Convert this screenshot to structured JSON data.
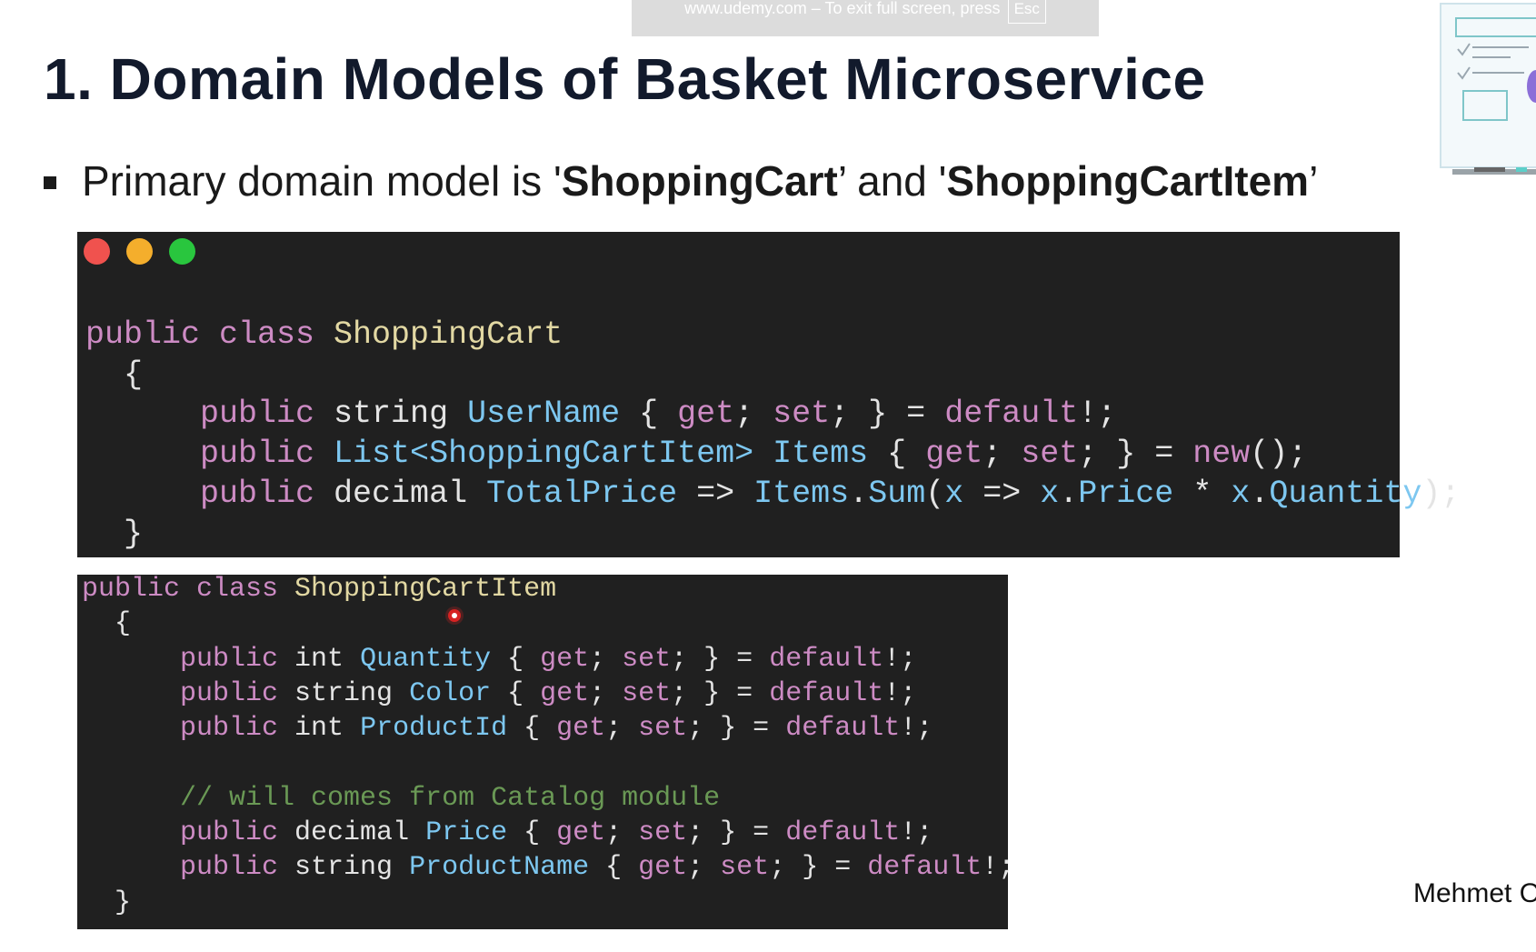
{
  "fullscreen_notice": {
    "text": "www.udemy.com – To exit full screen, press",
    "key": "Esc"
  },
  "slide": {
    "title": "1. Domain Models of Basket Microservice",
    "bullet": {
      "prefix": "Primary domain model is '",
      "model1": "ShoppingCart",
      "middle": "’ and '",
      "model2": "ShoppingCartItem",
      "suffix": "’"
    },
    "author": "Mehmet O"
  },
  "code_top": {
    "window_dots": [
      "close",
      "minimize",
      "maximize"
    ],
    "lines": [
      [
        {
          "t": "public class ",
          "c": "kw"
        },
        {
          "t": "ShoppingCart",
          "c": "cls"
        }
      ],
      [
        {
          "t": "  {",
          "c": "pun"
        }
      ],
      [
        {
          "t": "      public ",
          "c": "kw"
        },
        {
          "t": "string ",
          "c": "ty"
        },
        {
          "t": "UserName",
          "c": "prop"
        },
        {
          "t": " { ",
          "c": "pun"
        },
        {
          "t": "get",
          "c": "kw"
        },
        {
          "t": "; ",
          "c": "pun"
        },
        {
          "t": "set",
          "c": "kw"
        },
        {
          "t": "; } = ",
          "c": "pun"
        },
        {
          "t": "default",
          "c": "kw"
        },
        {
          "t": "!;",
          "c": "pun"
        }
      ],
      [
        {
          "t": "      public ",
          "c": "kw"
        },
        {
          "t": "List<ShoppingCartItem>",
          "c": "prop"
        },
        {
          "t": " ",
          "c": "pun"
        },
        {
          "t": "Items",
          "c": "prop"
        },
        {
          "t": " { ",
          "c": "pun"
        },
        {
          "t": "get",
          "c": "kw"
        },
        {
          "t": "; ",
          "c": "pun"
        },
        {
          "t": "set",
          "c": "kw"
        },
        {
          "t": "; } = ",
          "c": "pun"
        },
        {
          "t": "new",
          "c": "kw"
        },
        {
          "t": "();",
          "c": "pun"
        }
      ],
      [
        {
          "t": "      public ",
          "c": "kw"
        },
        {
          "t": "decimal ",
          "c": "ty"
        },
        {
          "t": "TotalPrice",
          "c": "prop"
        },
        {
          "t": " => ",
          "c": "pun"
        },
        {
          "t": "Items",
          "c": "prop"
        },
        {
          "t": ".",
          "c": "pun"
        },
        {
          "t": "Sum",
          "c": "prop"
        },
        {
          "t": "(",
          "c": "pun"
        },
        {
          "t": "x",
          "c": "prop"
        },
        {
          "t": " => ",
          "c": "pun"
        },
        {
          "t": "x",
          "c": "prop"
        },
        {
          "t": ".",
          "c": "pun"
        },
        {
          "t": "Price",
          "c": "prop"
        },
        {
          "t": " * ",
          "c": "pun"
        },
        {
          "t": "x",
          "c": "prop"
        },
        {
          "t": ".",
          "c": "pun"
        },
        {
          "t": "Quantity",
          "c": "prop"
        },
        {
          "t": ");",
          "c": "pun"
        }
      ],
      [
        {
          "t": "  }",
          "c": "pun"
        }
      ]
    ]
  },
  "code_bottom": {
    "lines": [
      [
        {
          "t": "public class ",
          "c": "kw"
        },
        {
          "t": "ShoppingCartItem",
          "c": "cls"
        }
      ],
      [
        {
          "t": "  {",
          "c": "pun"
        }
      ],
      [
        {
          "t": "      public ",
          "c": "kw"
        },
        {
          "t": "int ",
          "c": "ty"
        },
        {
          "t": "Quantity",
          "c": "prop"
        },
        {
          "t": " { ",
          "c": "pun"
        },
        {
          "t": "get",
          "c": "kw"
        },
        {
          "t": "; ",
          "c": "pun"
        },
        {
          "t": "set",
          "c": "kw"
        },
        {
          "t": "; } = ",
          "c": "pun"
        },
        {
          "t": "default",
          "c": "kw"
        },
        {
          "t": "!;",
          "c": "pun"
        }
      ],
      [
        {
          "t": "      public ",
          "c": "kw"
        },
        {
          "t": "string ",
          "c": "ty"
        },
        {
          "t": "Color",
          "c": "prop"
        },
        {
          "t": " { ",
          "c": "pun"
        },
        {
          "t": "get",
          "c": "kw"
        },
        {
          "t": "; ",
          "c": "pun"
        },
        {
          "t": "set",
          "c": "kw"
        },
        {
          "t": "; } = ",
          "c": "pun"
        },
        {
          "t": "default",
          "c": "kw"
        },
        {
          "t": "!;",
          "c": "pun"
        }
      ],
      [
        {
          "t": "      public ",
          "c": "kw"
        },
        {
          "t": "int ",
          "c": "ty"
        },
        {
          "t": "ProductId",
          "c": "prop"
        },
        {
          "t": " { ",
          "c": "pun"
        },
        {
          "t": "get",
          "c": "kw"
        },
        {
          "t": "; ",
          "c": "pun"
        },
        {
          "t": "set",
          "c": "kw"
        },
        {
          "t": "; } = ",
          "c": "pun"
        },
        {
          "t": "default",
          "c": "kw"
        },
        {
          "t": "!;",
          "c": "pun"
        }
      ],
      [
        {
          "t": "",
          "c": "pun"
        }
      ],
      [
        {
          "t": "      // will comes from Catalog module",
          "c": "cm"
        }
      ],
      [
        {
          "t": "      public ",
          "c": "kw"
        },
        {
          "t": "decimal ",
          "c": "ty"
        },
        {
          "t": "Price",
          "c": "prop"
        },
        {
          "t": " { ",
          "c": "pun"
        },
        {
          "t": "get",
          "c": "kw"
        },
        {
          "t": "; ",
          "c": "pun"
        },
        {
          "t": "set",
          "c": "kw"
        },
        {
          "t": "; } = ",
          "c": "pun"
        },
        {
          "t": "default",
          "c": "kw"
        },
        {
          "t": "!;",
          "c": "pun"
        }
      ],
      [
        {
          "t": "      public ",
          "c": "kw"
        },
        {
          "t": "string ",
          "c": "ty"
        },
        {
          "t": "ProductName",
          "c": "prop"
        },
        {
          "t": " { ",
          "c": "pun"
        },
        {
          "t": "get",
          "c": "kw"
        },
        {
          "t": "; ",
          "c": "pun"
        },
        {
          "t": "set",
          "c": "kw"
        },
        {
          "t": "; } = ",
          "c": "pun"
        },
        {
          "t": "default",
          "c": "kw"
        },
        {
          "t": "!;",
          "c": "pun"
        }
      ],
      [
        {
          "t": "  }",
          "c": "pun"
        }
      ]
    ]
  },
  "colors": {
    "keyword": "#cd8bc4",
    "class_name": "#e2d8a3",
    "identifier": "#7dc7f0",
    "comment": "#6a9955",
    "code_background": "#202020",
    "title_text": "#121a2c"
  }
}
